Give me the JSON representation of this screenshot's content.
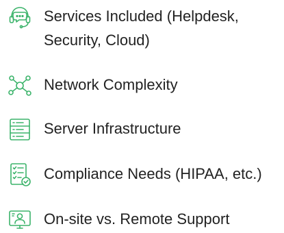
{
  "accent_color": "#3bb36a",
  "items": [
    {
      "icon": "headset-chat-icon",
      "label": "Services Included (Helpdesk, Security, Cloud)"
    },
    {
      "icon": "network-nodes-icon",
      "label": "Network Complexity"
    },
    {
      "icon": "server-rack-icon",
      "label": "Server Infrastructure"
    },
    {
      "icon": "checklist-document-icon",
      "label": "Compliance Needs (HIPAA, etc.)"
    },
    {
      "icon": "remote-support-monitor-icon",
      "label": "On-site vs. Remote Support"
    }
  ]
}
